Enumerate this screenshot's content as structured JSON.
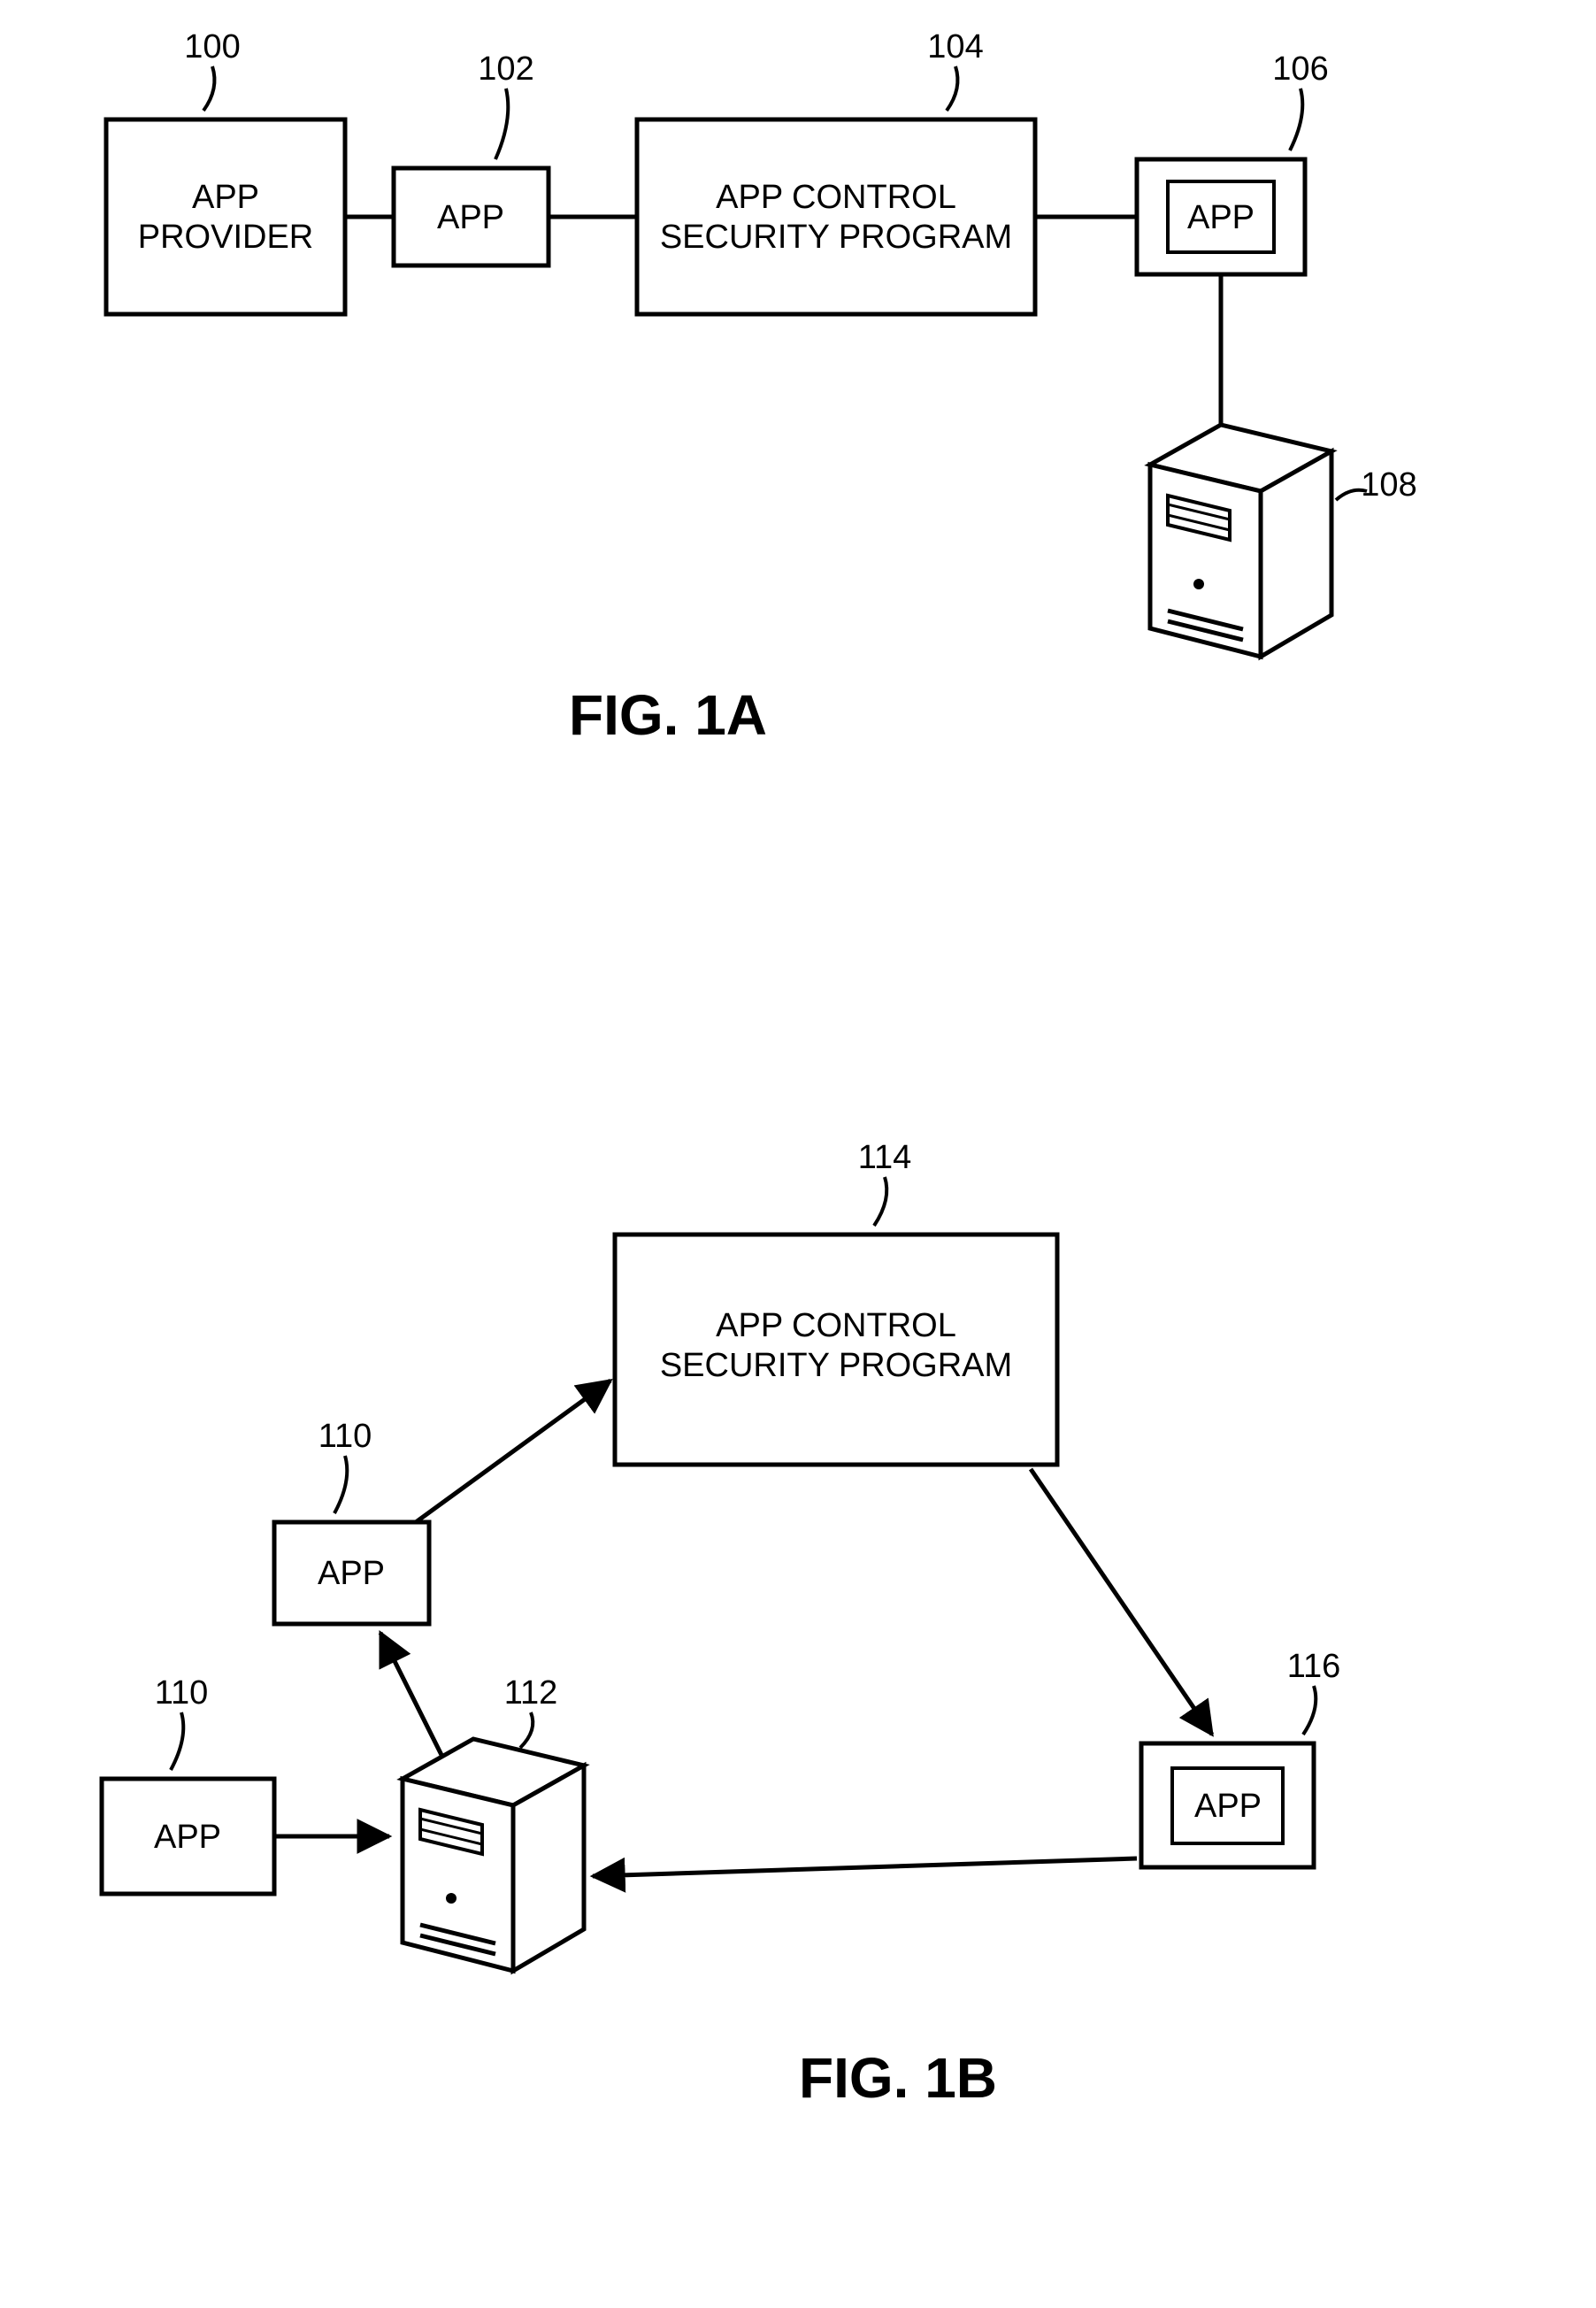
{
  "figA": {
    "title": "FIG. 1A",
    "boxes": {
      "provider": {
        "ref": "100",
        "line1": "APP",
        "line2": "PROVIDER"
      },
      "app": {
        "ref": "102",
        "label": "APP"
      },
      "control": {
        "ref": "104",
        "line1": "APP CONTROL",
        "line2": "SECURITY PROGRAM"
      },
      "device": {
        "ref": "106",
        "label": "APP"
      },
      "server": {
        "ref": "108"
      }
    }
  },
  "figB": {
    "title": "FIG. 1B",
    "boxes": {
      "app1": {
        "ref": "110",
        "label": "APP"
      },
      "app2": {
        "ref": "110",
        "label": "APP"
      },
      "server": {
        "ref": "112"
      },
      "control": {
        "ref": "114",
        "line1": "APP CONTROL",
        "line2": "SECURITY PROGRAM"
      },
      "device": {
        "ref": "116",
        "label": "APP"
      }
    }
  }
}
